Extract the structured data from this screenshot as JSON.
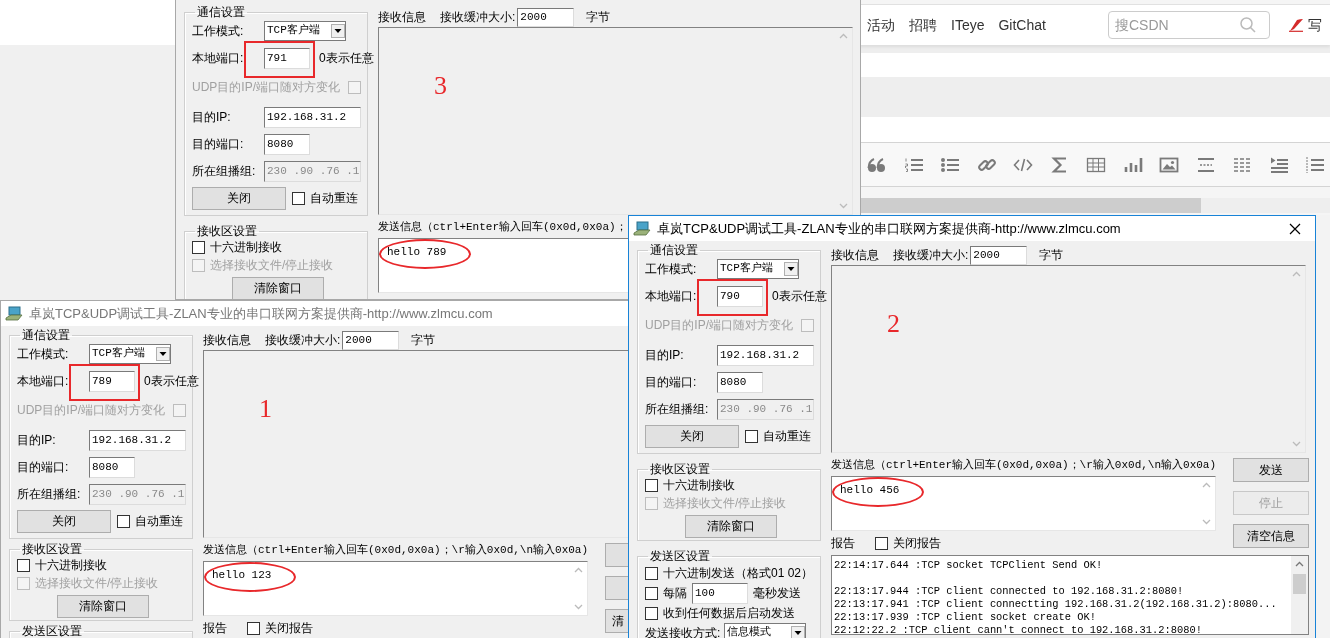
{
  "browser": {
    "nav_links": [
      "活动",
      "招聘",
      "ITeye",
      "GitChat"
    ],
    "search": {
      "placeholder": "搜CSDN"
    },
    "write_link": "写"
  },
  "windows": [
    {
      "active": false,
      "comm": {
        "title": "通信设置",
        "mode_label": "工作模式:",
        "mode": "TCP客户端",
        "port_label": "本地端口:",
        "port": "791",
        "port_hint": "0表示任意",
        "port_marked": true,
        "udp_label": "UDP目的IP/端口随对方变化",
        "udp_checked": false,
        "udp_disabled": true,
        "ip_label": "目的IP:",
        "ip": "192.168.31.2",
        "dport_label": "目的端口:",
        "dport": "8080",
        "group_label": "所在组播组:",
        "group": "230 .90 .76 .1",
        "group_disabled": true,
        "close_button": "关闭",
        "auto_label": "自动重连",
        "auto_checked": false
      },
      "recv_settings": {
        "title": "接收区设置",
        "hex_label": "十六进制接收",
        "hex_checked": false,
        "file_label": "选择接收文件/停止接收",
        "file_checked": false,
        "file_disabled": true,
        "clear_button": "清除窗口"
      },
      "recv": {
        "label": "接收信息",
        "buffer_label": "接收缓冲大小:",
        "buffer": "2000",
        "unit": "字节",
        "note": "3"
      },
      "send": {
        "label": "发送信息（ctrl+Enter输入回车(0x0d,0x0a)；",
        "text": "hello 789",
        "circled": true
      }
    },
    {
      "active": false,
      "title": "卓岚TCP&UDP调试工具-ZLAN专业的串口联网方案提供商-http://www.zlmcu.com",
      "comm": {
        "title": "通信设置",
        "mode_label": "工作模式:",
        "mode": "TCP客户端",
        "port_label": "本地端口:",
        "port": "789",
        "port_hint": "0表示任意",
        "port_marked": true,
        "udp_label": "UDP目的IP/端口随对方变化",
        "udp_checked": false,
        "udp_disabled": true,
        "ip_label": "目的IP:",
        "ip": "192.168.31.2",
        "dport_label": "目的端口:",
        "dport": "8080",
        "group_label": "所在组播组:",
        "group": "230 .90 .76 .1",
        "group_disabled": true,
        "close_button": "关闭",
        "auto_label": "自动重连",
        "auto_checked": false
      },
      "recv_settings": {
        "title": "接收区设置",
        "hex_label": "十六进制接收",
        "hex_checked": false,
        "file_label": "选择接收文件/停止接收",
        "file_checked": false,
        "file_disabled": true,
        "clear_button": "清除窗口"
      },
      "send_settings": {
        "title": "发送区设置"
      },
      "recv": {
        "label": "接收信息",
        "buffer_label": "接收缓冲大小:",
        "buffer": "2000",
        "unit": "字节",
        "note": "1"
      },
      "send": {
        "label": "发送信息（ctrl+Enter输入回车(0x0d,0x0a)；\\r输入0x0d,\\n输入0x0a)",
        "text": "hello 123",
        "circled": true
      },
      "buttons": [
        {
          "kind": "blank"
        },
        {
          "kind": "blank"
        },
        {
          "kind": "labeled",
          "label": "清"
        }
      ],
      "report": {
        "label": "报告",
        "close_label": "关闭报告",
        "checked": false
      }
    },
    {
      "active": true,
      "title": "卓岚TCP&UDP调试工具-ZLAN专业的串口联网方案提供商-http://www.zlmcu.com",
      "close_button": true,
      "comm": {
        "title": "通信设置",
        "mode_label": "工作模式:",
        "mode": "TCP客户端",
        "port_label": "本地端口:",
        "port": "790",
        "port_hint": "0表示任意",
        "port_marked": true,
        "udp_label": "UDP目的IP/端口随对方变化",
        "udp_checked": false,
        "udp_disabled": true,
        "ip_label": "目的IP:",
        "ip": "192.168.31.2",
        "dport_label": "目的端口:",
        "dport": "8080",
        "group_label": "所在组播组:",
        "group": "230 .90 .76 .1",
        "group_disabled": true,
        "close_button": "关闭",
        "auto_label": "自动重连",
        "auto_checked": false
      },
      "recv_settings": {
        "title": "接收区设置",
        "hex_label": "十六进制接收",
        "hex_checked": false,
        "file_label": "选择接收文件/停止接收",
        "file_checked": false,
        "file_disabled": true,
        "clear_button": "清除窗口"
      },
      "send_settings": {
        "title": "发送区设置",
        "hex_label": "十六进制发送（格式01 02）",
        "hex_checked": false,
        "interval_label": "每隔",
        "interval": "100",
        "interval_unit": "毫秒发送",
        "interval_checked": false,
        "auto_label": "收到任何数据后启动发送",
        "auto_checked": false,
        "mode_label": "发送接收方式:",
        "mode": "信息模式"
      },
      "recv": {
        "label": "接收信息",
        "buffer_label": "接收缓冲大小:",
        "buffer": "2000",
        "unit": "字节",
        "note": "2"
      },
      "send": {
        "label": "发送信息（ctrl+Enter输入回车(0x0d,0x0a)；\\r输入0x0d,\\n输入0x0a)",
        "text": "hello 456",
        "circled": true
      },
      "buttons": [
        {
          "kind": "labeled",
          "label": "发送",
          "disabled": false
        },
        {
          "kind": "labeled",
          "label": "停止",
          "disabled": true
        },
        {
          "kind": "labeled",
          "label": "清空信息",
          "disabled": false
        }
      ],
      "report": {
        "label": "报告",
        "close_label": "关闭报告",
        "checked": false
      },
      "log_blocks": [
        [
          "22:14:17.644 :TCP socket TCPClient Send OK!"
        ],
        [
          "22:13:17.944 :TCP client connected to 192.168.31.2:8080!",
          "22:13:17.941 :TCP client connectting 192.168.31.2(192.168.31.2):8080...",
          "22:13:17.939 :TCP client socket create OK!",
          "22:12:22.2 :TCP client cann't connect to 192.168.31.2:8080!"
        ]
      ]
    }
  ]
}
